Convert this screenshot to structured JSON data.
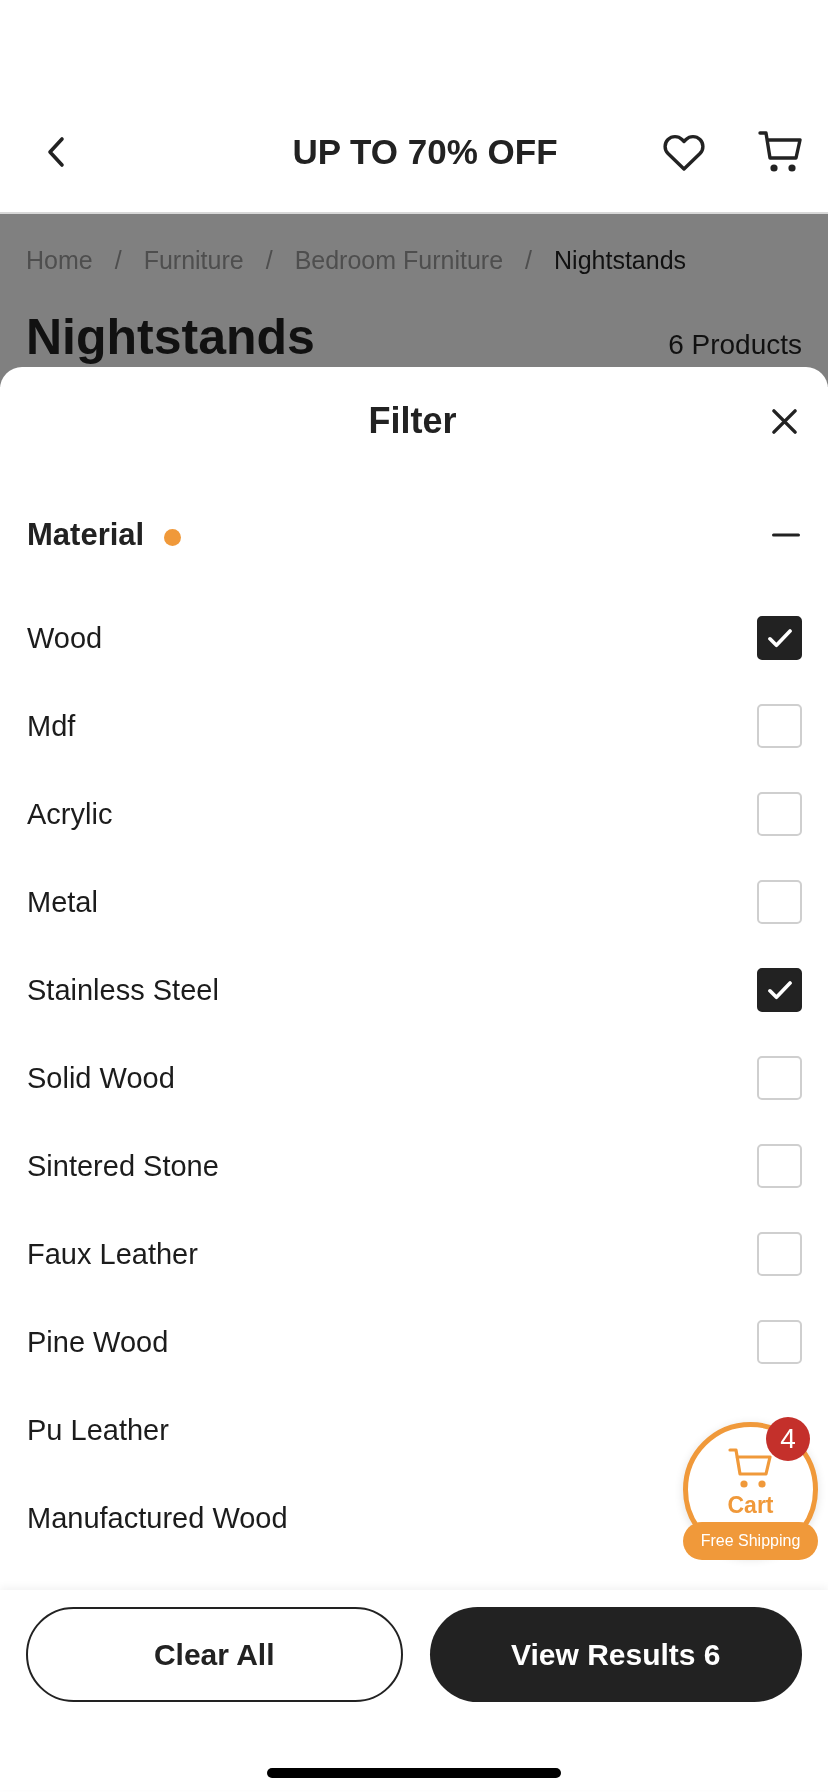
{
  "header": {
    "title": "UP TO 70% OFF"
  },
  "breadcrumb": [
    {
      "kind": "link",
      "text": "Home"
    },
    {
      "kind": "separator",
      "text": "/"
    },
    {
      "kind": "link",
      "text": "Furniture"
    },
    {
      "kind": "separator",
      "text": "/"
    },
    {
      "kind": "link",
      "text": "Bedroom Furniture"
    },
    {
      "kind": "separator",
      "text": "/"
    },
    {
      "kind": "current",
      "text": "Nightstands"
    }
  ],
  "page": {
    "title": "Nightstands",
    "count": "6 Products"
  },
  "filter": {
    "title": "Filter",
    "sections": [
      {
        "title": "Material",
        "expanded": true,
        "active": true,
        "options": [
          {
            "label": "Wood",
            "checked": true
          },
          {
            "label": "Mdf",
            "checked": false
          },
          {
            "label": "Acrylic",
            "checked": false
          },
          {
            "label": "Metal",
            "checked": false
          },
          {
            "label": "Stainless Steel",
            "checked": true
          },
          {
            "label": "Solid Wood",
            "checked": false
          },
          {
            "label": "Sintered Stone",
            "checked": false
          },
          {
            "label": "Faux Leather",
            "checked": false
          },
          {
            "label": "Pine Wood",
            "checked": false
          },
          {
            "label": "Pu Leather"
          },
          {
            "label": "Manufactured Wood"
          }
        ]
      }
    ]
  },
  "actions": [
    {
      "kind": "secondary",
      "label": "Clear All"
    },
    {
      "kind": "primary",
      "label": "View Results 6"
    }
  ],
  "floating_cart": {
    "badge": "4",
    "label": "Cart",
    "note": "Free Shipping"
  }
}
